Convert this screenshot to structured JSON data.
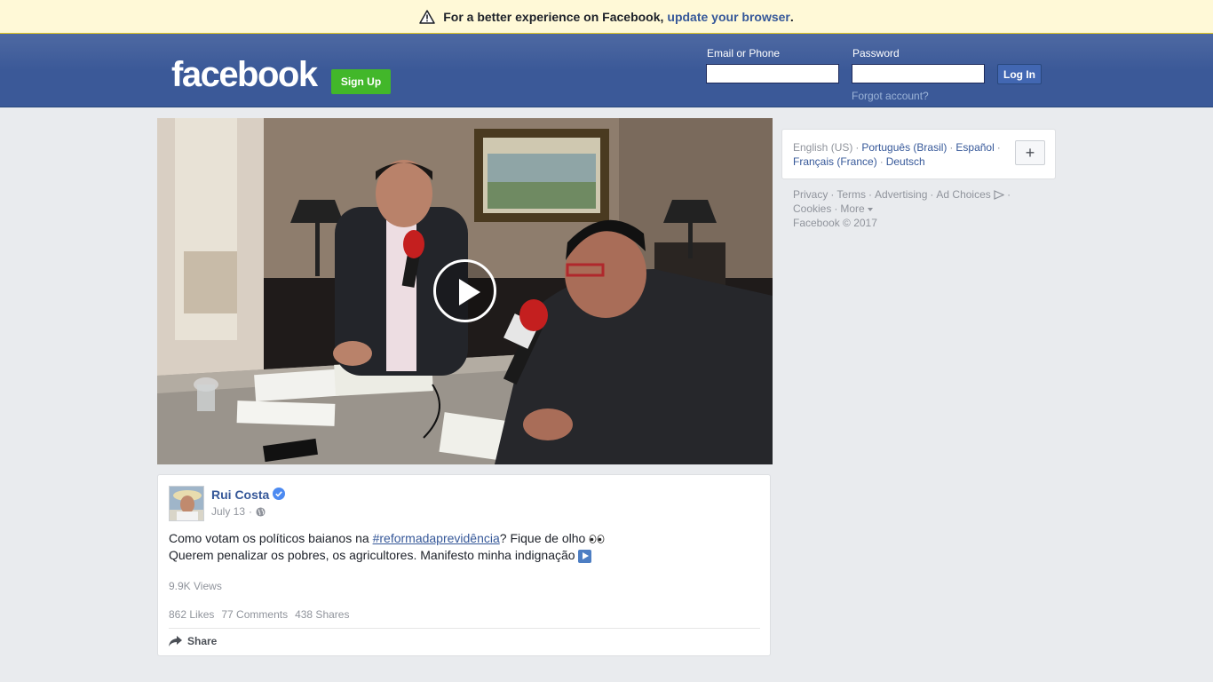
{
  "banner": {
    "text": "For a better experience on Facebook,",
    "link": "update your browser",
    "end": "."
  },
  "header": {
    "logo": "facebook",
    "signup_label": "Sign Up",
    "email_label": "Email or Phone",
    "password_label": "Password",
    "email_value": "",
    "password_value": "",
    "login_label": "Log In",
    "forgot_label": "Forgot account?"
  },
  "post": {
    "author": "Rui Costa",
    "date": "July 13",
    "separator": "·",
    "text_line1_pre": "Como votam os políticos baianos na ",
    "hashtag": "#reformadaprevidência",
    "text_line1_post": "? Fique de olho ",
    "text_line2": "Querem penalizar os pobres, os agricultores. Manifesto minha indignação ",
    "views": "9.9K Views",
    "likes": "862 Likes",
    "comments": "77 Comments",
    "shares": "438 Shares",
    "share_label": "Share"
  },
  "languages": {
    "current": "English (US)",
    "items": [
      "Português (Brasil)",
      "Español",
      "Français (France)",
      "Deutsch"
    ],
    "more_label": "+"
  },
  "footer": {
    "links": [
      "Privacy",
      "Terms",
      "Advertising",
      "Ad Choices",
      "Cookies",
      "More"
    ],
    "copyright": "Facebook © 2017"
  },
  "colors": {
    "brand_blue": "#3b5998",
    "link_blue": "#365899",
    "signup_green": "#42b72a",
    "banner_yellow": "#fff9d7",
    "page_bg": "#e9ebee"
  },
  "icons": [
    "warning-icon",
    "play-icon",
    "verified-icon",
    "globe-icon",
    "eyes-emoji",
    "play-emoji",
    "share-icon",
    "ad-choices-icon",
    "caret-down-icon"
  ]
}
